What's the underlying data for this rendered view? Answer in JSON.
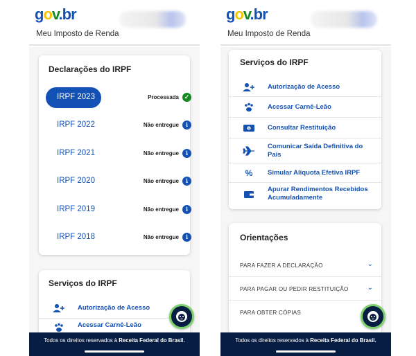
{
  "brand": {
    "logo_g": "g",
    "logo_o": "o",
    "logo_v": "v",
    "logo_dot": ".",
    "logo_br": "br"
  },
  "app_title": "Meu Imposto de Renda",
  "declarations": {
    "title": "Declarações do IRPF",
    "items": [
      {
        "year": "IRPF 2023",
        "status": "Processada",
        "status_icon": "check-icon"
      },
      {
        "year": "IRPF 2022",
        "status": "Não entregue",
        "status_icon": "info-icon"
      },
      {
        "year": "IRPF 2021",
        "status": "Não entregue",
        "status_icon": "info-icon"
      },
      {
        "year": "IRPF 2020",
        "status": "Não entregue",
        "status_icon": "info-icon"
      },
      {
        "year": "IRPF 2019",
        "status": "Não entregue",
        "status_icon": "info-icon"
      },
      {
        "year": "IRPF 2018",
        "status": "Não entregue",
        "status_icon": "info-icon"
      }
    ]
  },
  "services": {
    "title": "Serviços do IRPF",
    "items": [
      {
        "label": "Autorização de Acesso",
        "icon": "user-plus-icon"
      },
      {
        "label": "Acessar Carnê-Leão",
        "icon": "paw-icon"
      },
      {
        "label": "Consultar Restituição",
        "icon": "money-icon"
      },
      {
        "label": "Comunicar Saída Definitiva do País",
        "icon": "airplane-icon"
      },
      {
        "label": "Simular Alíquota Efetiva IRPF",
        "icon": "percent-icon"
      },
      {
        "label": "Apurar Rendimentos Recebidos Acumuladamente",
        "icon": "wallet-icon"
      }
    ]
  },
  "orientations": {
    "title": "Orientações",
    "items": [
      {
        "label": "PARA FAZER A DECLARAÇÃO"
      },
      {
        "label": "PARA PAGAR OU PEDIR RESTITUIÇÃO"
      },
      {
        "label": "PARA OBTER CÓPIAS"
      }
    ]
  },
  "footer": {
    "prefix": "Todos os direitos reservados à ",
    "org": "Receita Federal do Brasil."
  },
  "colors": {
    "primary": "#1351b4",
    "footer_bg": "#071d41",
    "success": "#168821",
    "fab_ring": "#7bd16a"
  }
}
